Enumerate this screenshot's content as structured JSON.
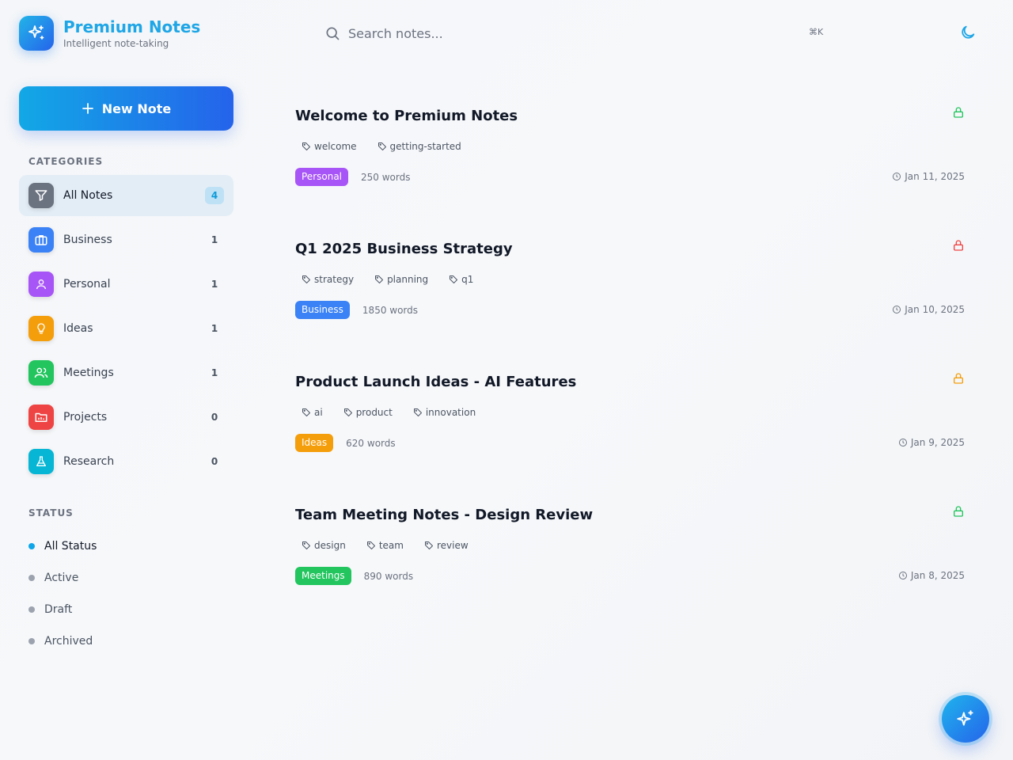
{
  "brand": {
    "title": "Premium Notes",
    "subtitle": "Intelligent note-taking"
  },
  "new_note_label": "New Note",
  "categories": {
    "heading": "CATEGORIES",
    "items": [
      {
        "label": "All Notes",
        "count": "4",
        "color": "#6b7280",
        "icon": "filter-icon"
      },
      {
        "label": "Business",
        "count": "1",
        "color": "#3b82f6",
        "icon": "briefcase-icon"
      },
      {
        "label": "Personal",
        "count": "1",
        "color": "#a855f7",
        "icon": "user-icon"
      },
      {
        "label": "Ideas",
        "count": "1",
        "color": "#f59e0b",
        "icon": "lightbulb-icon"
      },
      {
        "label": "Meetings",
        "count": "1",
        "color": "#22c55e",
        "icon": "users-icon"
      },
      {
        "label": "Projects",
        "count": "0",
        "color": "#ef4444",
        "icon": "folder-icon"
      },
      {
        "label": "Research",
        "count": "0",
        "color": "#06b6d4",
        "icon": "flask-icon"
      }
    ]
  },
  "status": {
    "heading": "STATUS",
    "items": [
      {
        "label": "All Status"
      },
      {
        "label": "Active"
      },
      {
        "label": "Draft"
      },
      {
        "label": "Archived"
      }
    ]
  },
  "search": {
    "placeholder": "Search notes...",
    "shortcut": "⌘K"
  },
  "notes": [
    {
      "title": "Welcome to Premium Notes",
      "tags": [
        "welcome",
        "getting-started"
      ],
      "category": "Personal",
      "category_color": "#a855f7",
      "words": "250 words",
      "date": "Jan 11, 2025",
      "lock_color": "#22c55e"
    },
    {
      "title": "Q1 2025 Business Strategy",
      "tags": [
        "strategy",
        "planning",
        "q1"
      ],
      "category": "Business",
      "category_color": "#3b82f6",
      "words": "1850 words",
      "date": "Jan 10, 2025",
      "lock_color": "#ef4444"
    },
    {
      "title": "Product Launch Ideas - AI Features",
      "tags": [
        "ai",
        "product",
        "innovation"
      ],
      "category": "Ideas",
      "category_color": "#f59e0b",
      "words": "620 words",
      "date": "Jan 9, 2025",
      "lock_color": "#f59e0b"
    },
    {
      "title": "Team Meeting Notes - Design Review",
      "tags": [
        "design",
        "team",
        "review"
      ],
      "category": "Meetings",
      "category_color": "#22c55e",
      "words": "890 words",
      "date": "Jan 8, 2025",
      "lock_color": "#22c55e"
    }
  ]
}
